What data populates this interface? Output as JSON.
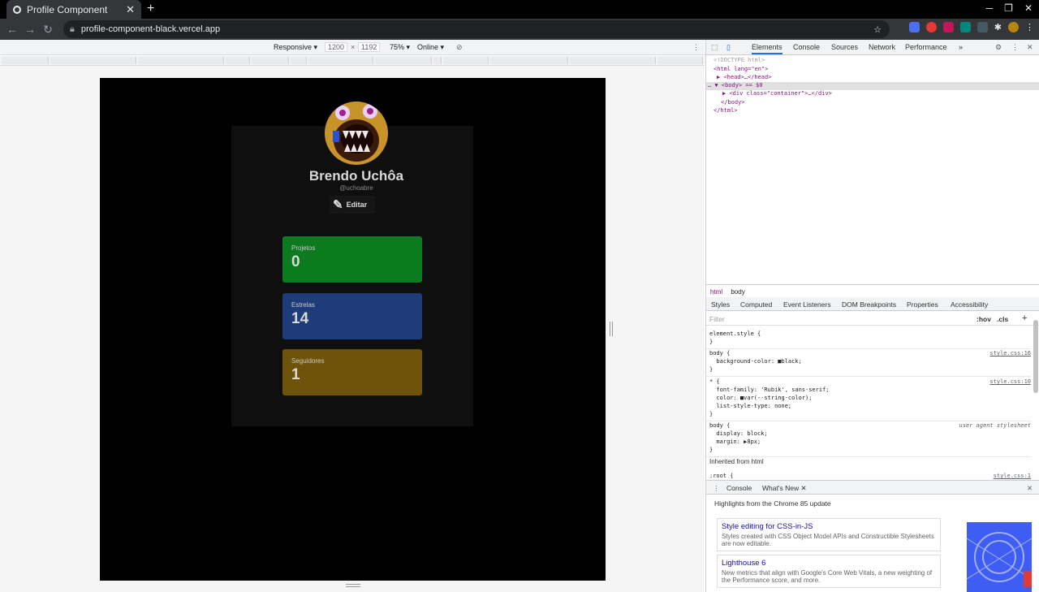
{
  "browser": {
    "tab_title": "Profile Component",
    "url": "profile-component-black.vercel.app"
  },
  "device_toolbar": {
    "mode": "Responsive",
    "width": "1200",
    "height": "1192",
    "zoom": "75%",
    "network": "Online"
  },
  "profile": {
    "name": "Brendo Uchôa",
    "handle": "@uchoabre",
    "edit_label": "Editar",
    "stats": [
      {
        "label": "Projetos",
        "value": "0",
        "color": "#0c7a1f"
      },
      {
        "label": "Estrelas",
        "value": "14",
        "color": "#1f3c7a"
      },
      {
        "label": "Seguidores",
        "value": "1",
        "color": "#6e540a"
      }
    ]
  },
  "devtools": {
    "tabs": [
      "Elements",
      "Console",
      "Sources",
      "Network",
      "Performance"
    ],
    "dom": {
      "doctype": "<!DOCTYPE html>",
      "html_open": "<html lang=\"en\">",
      "head": "<head>…</head>",
      "body_open": "<body> == $0",
      "div": "<div class=\"container\">…</div>",
      "body_close": "</body>",
      "html_close": "</html>"
    },
    "breadcrumbs": [
      "html",
      "body"
    ],
    "style_tabs": [
      "Styles",
      "Computed",
      "Event Listeners",
      "DOM Breakpoints",
      "Properties",
      "Accessibility"
    ],
    "filter_placeholder": "Filter",
    "hov": ":hov",
    "cls": ".cls",
    "rules": [
      {
        "text": "element.style {\n}",
        "source": ""
      },
      {
        "text": "body {\n  background-color: ■black;\n}",
        "source": "style.css:16"
      },
      {
        "text": "* {\n  font-family: 'Rubik', sans-serif;\n  color: ■var(--string-color);\n  list-style-type: none;\n}",
        "source": "style.css:10"
      },
      {
        "text": "body {\n  display: block;\n  margin: ▶8px;\n}",
        "source": "user agent stylesheet"
      }
    ],
    "inherited": "Inherited from html",
    "root_rule": ":root {",
    "root_source": "style.css:1",
    "drawer_tabs": [
      "Console",
      "What's New"
    ],
    "highlights": "Highlights from the Chrome 85 update",
    "news": [
      {
        "title": "Style editing for CSS-in-JS",
        "desc": "Styles created with CSS Object Model APIs and Constructible Stylesheets are now editable."
      },
      {
        "title": "Lighthouse 6",
        "desc": "New metrics that align with Google's Core Web Vitals, a new weighting of the Performance score, and more."
      }
    ]
  }
}
